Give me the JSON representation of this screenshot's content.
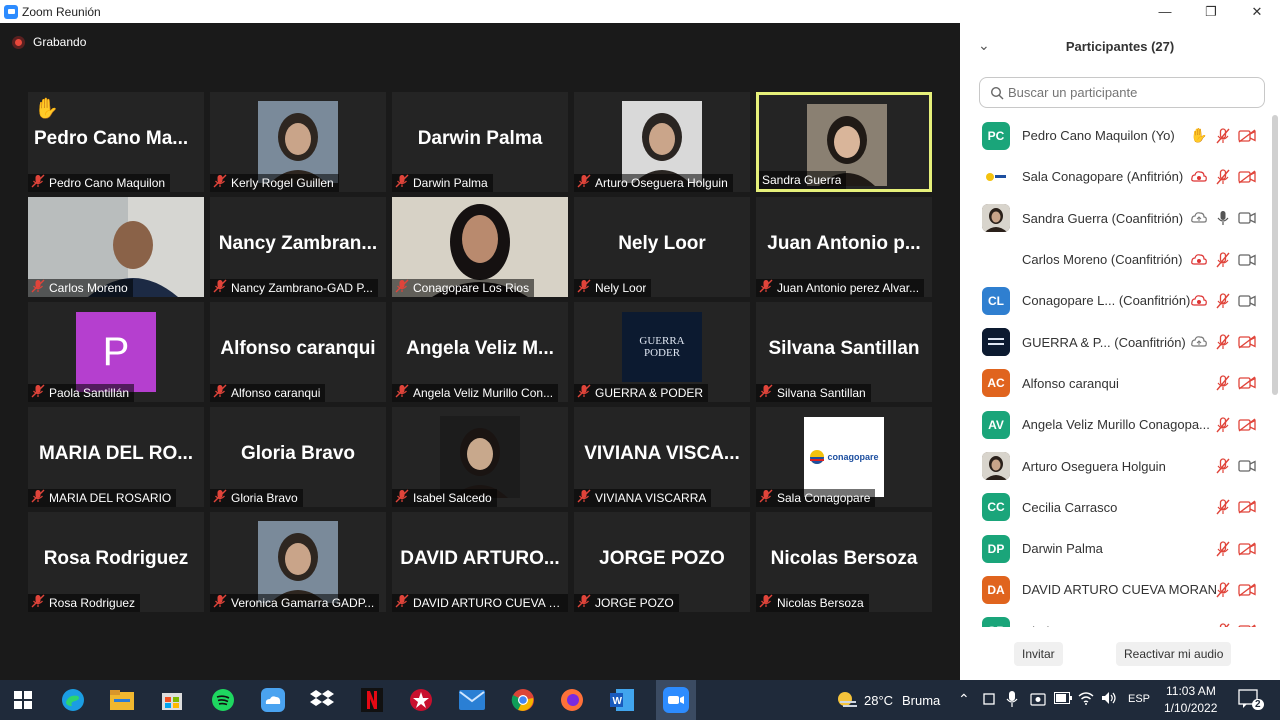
{
  "window": {
    "title": "Zoom Reunión",
    "minimize": "—",
    "maximize": "❐",
    "close": "✕"
  },
  "recording": {
    "label": "Grabando"
  },
  "tiles": [
    {
      "caption": "Pedro Cano Maquilon",
      "display": "Pedro  Cano  Ma...",
      "kind": "name",
      "hand": true
    },
    {
      "caption": "Kerly Rogel Guillen",
      "kind": "photo"
    },
    {
      "caption": "Darwin Palma",
      "display": "Darwin Palma",
      "kind": "name"
    },
    {
      "caption": "Arturo Oseguera Holguin",
      "kind": "photo"
    },
    {
      "caption": "Sandra Guerra",
      "kind": "photo",
      "active": true,
      "unmuted": true
    },
    {
      "caption": "Carlos Moreno",
      "kind": "video"
    },
    {
      "caption": "Nancy Zambrano-GAD P...",
      "display": "Nancy  Zambran...",
      "kind": "name"
    },
    {
      "caption": "Conagopare Los Rios",
      "kind": "video"
    },
    {
      "caption": "Nely Loor",
      "display": "Nely Loor",
      "kind": "name"
    },
    {
      "caption": "Juan Antonio perez Alvar...",
      "display": "Juan  Antonio  p...",
      "kind": "name"
    },
    {
      "caption": "Paola Santillán",
      "kind": "avatar",
      "letter": "P"
    },
    {
      "caption": "Alfonso caranqui",
      "display": "Alfonso caranqui",
      "kind": "name"
    },
    {
      "caption": "Angela Veliz Murillo Con...",
      "display": "Angela  Veliz  M...",
      "kind": "name"
    },
    {
      "caption": "GUERRA & PODER",
      "kind": "logo",
      "logo_line1": "GUERRA",
      "logo_line2": "PODER"
    },
    {
      "caption": "Silvana Santillan",
      "display": "Silvana Santillan",
      "kind": "name"
    },
    {
      "caption": "MARIA DEL ROSARIO",
      "display": "MARIA  DEL  RO...",
      "kind": "name"
    },
    {
      "caption": "Gloria Bravo",
      "display": "Gloria Bravo",
      "kind": "name"
    },
    {
      "caption": "Isabel Salcedo",
      "kind": "photo"
    },
    {
      "caption": "VIVIANA VISCARRA",
      "display": "VIVIANA  VISCA...",
      "kind": "name"
    },
    {
      "caption": "Sala Conagopare",
      "kind": "conagopare",
      "logo_text": "conagopare"
    },
    {
      "caption": "Rosa Rodriguez",
      "display": "Rosa Rodriguez",
      "kind": "name"
    },
    {
      "caption": "Veronica Gamarra GADP...",
      "kind": "photo"
    },
    {
      "caption": "DAVID ARTURO CUEVA M...",
      "display": "DAVID  ARTURO...",
      "kind": "name"
    },
    {
      "caption": "JORGE POZO",
      "display": "JORGE POZO",
      "kind": "name"
    },
    {
      "caption": "Nicolas Bersoza",
      "display": "Nicolas Bersoza",
      "kind": "name"
    }
  ],
  "panel": {
    "title": "Participantes (27)",
    "search_placeholder": "Buscar un participante",
    "invite": "Invitar",
    "unmute": "Reactivar mi audio",
    "participants": [
      {
        "initials": "PC",
        "name": "Pedro Cano Maquilon (Yo)",
        "color": "#1aa57a",
        "hand": true,
        "mic": "muted",
        "video": "off"
      },
      {
        "initials": "",
        "name": "Sala Conagopare (Anfitrión)",
        "color": "#ffffff",
        "rec": true,
        "mic": "muted",
        "video": "off",
        "avatar": "conagopare"
      },
      {
        "initials": "",
        "name": "Sandra Guerra (Coanfitrión)",
        "color": "#5a4a44",
        "cloud": true,
        "mic": "on",
        "video": "on",
        "avatar": "photo"
      },
      {
        "initials": "",
        "name": "Carlos Moreno (Coanfitrión)",
        "color": "#ffffff",
        "rec": true,
        "mic": "muted",
        "video": "on"
      },
      {
        "initials": "CL",
        "name": "Conagopare L...  (Coanfitrión)",
        "color": "#2f7fd0",
        "rec": true,
        "mic": "muted",
        "video": "on"
      },
      {
        "initials": "",
        "name": "GUERRA & P...  (Coanfitrión)",
        "color": "#102040",
        "cloud": true,
        "mic": "muted",
        "video": "off",
        "avatar": "logo"
      },
      {
        "initials": "AC",
        "name": "Alfonso caranqui",
        "color": "#e0641e",
        "mic": "muted",
        "video": "off"
      },
      {
        "initials": "AV",
        "name": "Angela Veliz Murillo Conagopa...",
        "color": "#1aa57a",
        "mic": "muted",
        "video": "off"
      },
      {
        "initials": "",
        "name": "Arturo Oseguera Holguin",
        "color": "#6a5040",
        "mic": "muted",
        "video": "on",
        "avatar": "photo"
      },
      {
        "initials": "CC",
        "name": "Cecilia Carrasco",
        "color": "#1aa57a",
        "mic": "muted",
        "video": "off"
      },
      {
        "initials": "DP",
        "name": "Darwin Palma",
        "color": "#1aa57a",
        "mic": "muted",
        "video": "off"
      },
      {
        "initials": "DA",
        "name": "DAVID ARTURO CUEVA MORAN",
        "color": "#e0641e",
        "mic": "muted",
        "video": "off"
      },
      {
        "initials": "GB",
        "name": "Gloria Bravo",
        "color": "#1aa57a",
        "mic": "muted",
        "video": "off"
      }
    ]
  },
  "taskbar": {
    "weather_temp": "28°C",
    "weather_desc": "Bruma",
    "lang": "ESP",
    "time": "11:03 AM",
    "date": "1/10/2022",
    "notif_count": "2"
  }
}
